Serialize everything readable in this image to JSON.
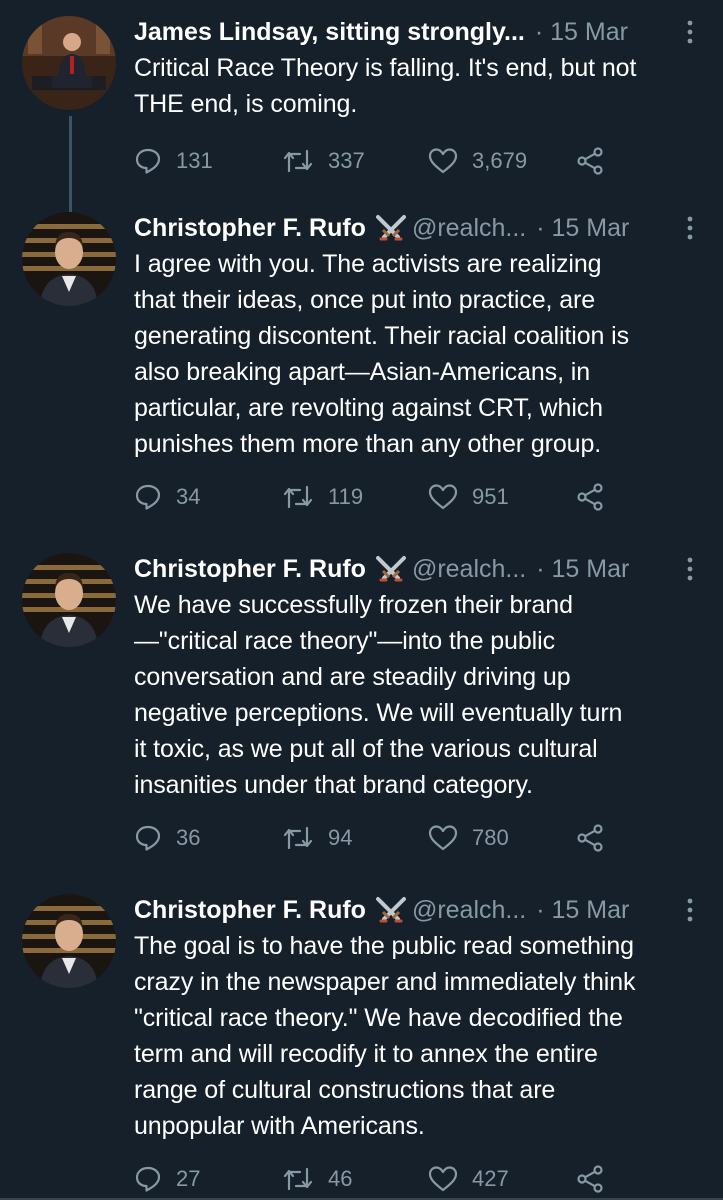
{
  "tweets": [
    {
      "author": "James Lindsay, sitting strongly...",
      "handle": "",
      "date": "· 15 Mar",
      "text_lines": [
        "Critical Race Theory is falling. It's end, but not",
        "THE end, is coming."
      ],
      "replies": "131",
      "retweets": "337",
      "likes": "3,679"
    },
    {
      "author": "Christopher F. Rufo",
      "handle": "@realch...",
      "date": "· 15 Mar",
      "text_lines": [
        "I agree with you. The activists are realizing",
        "that their ideas, once put into practice, are",
        "generating discontent. Their racial coalition is",
        "also breaking apart—Asian-Americans, in",
        "particular, are revolting against CRT, which",
        "punishes them more than any other group."
      ],
      "replies": "34",
      "retweets": "119",
      "likes": "951"
    },
    {
      "author": "Christopher F. Rufo",
      "handle": "@realch...",
      "date": "· 15 Mar",
      "text_lines": [
        "We have successfully frozen their brand",
        "—\"critical race theory\"—into the public",
        "conversation and are steadily driving up",
        "negative perceptions. We will eventually turn",
        "it toxic, as we put all of the various cultural",
        "insanities under that brand category."
      ],
      "replies": "36",
      "retweets": "94",
      "likes": "780"
    },
    {
      "author": "Christopher F. Rufo",
      "handle": "@realch...",
      "date": "· 15 Mar",
      "text_lines": [
        "The goal is to have the public read something",
        "crazy in the newspaper and immediately think",
        "\"critical race theory.\" We have decodified the",
        "term and will recodify it to annex the entire",
        "range of cultural constructions that are",
        "unpopular with Americans."
      ],
      "replies": "27",
      "retweets": "46",
      "likes": "427"
    }
  ],
  "icons": {
    "reply": "reply-icon",
    "retweet": "retweet-icon",
    "like": "heart-icon",
    "share": "share-icon",
    "more": "more-vertical-icon",
    "badge": "crossed-swords-icon"
  },
  "colors": {
    "background": "#15202b",
    "text": "#ffffff",
    "secondary": "#8899a6",
    "thread_line": "#3d5466"
  }
}
